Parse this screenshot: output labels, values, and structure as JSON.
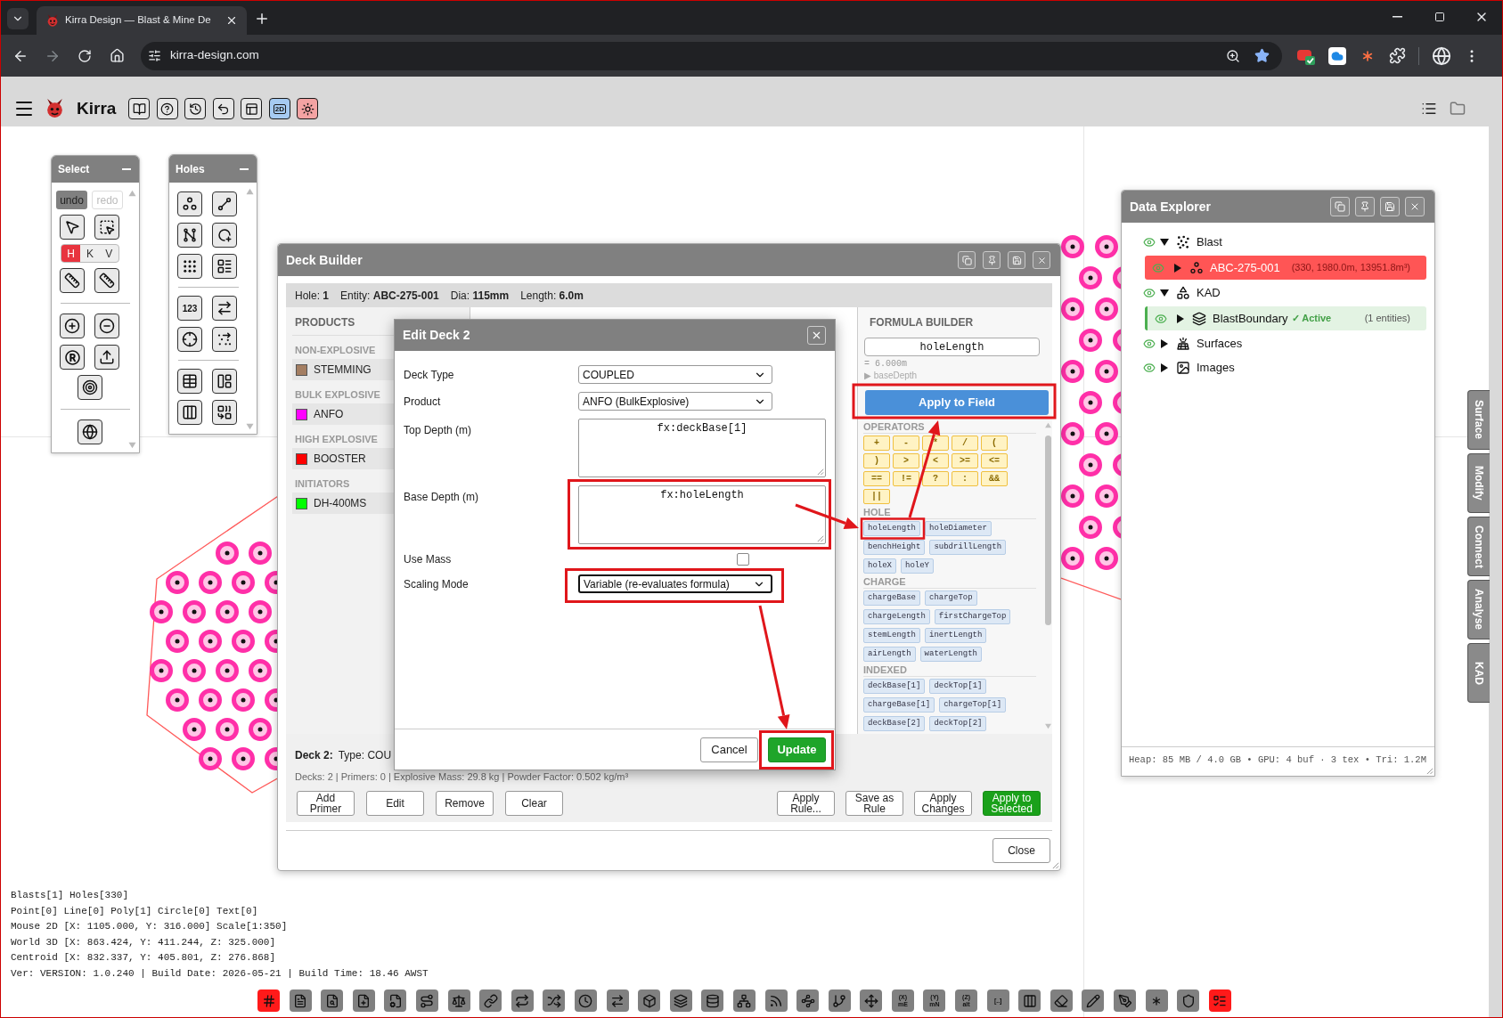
{
  "browser": {
    "tab_title": "Kirra Design — Blast & Mine De",
    "url": "kirra-design.com"
  },
  "app_header": {
    "app_name": "Kirra",
    "tools": [
      {
        "kind": "book",
        "selected": false
      },
      {
        "kind": "help",
        "selected": false
      },
      {
        "kind": "history",
        "selected": false
      },
      {
        "kind": "undo",
        "selected": false
      },
      {
        "kind": "layout",
        "selected": false
      },
      {
        "kind": "view",
        "label": "2D",
        "selected": true
      },
      {
        "kind": "theme",
        "selected": true
      }
    ]
  },
  "select_panel": {
    "title": "Select",
    "history": [
      {
        "label": "undo",
        "disabled": false
      },
      {
        "label": "redo",
        "disabled": true
      }
    ],
    "modes": [
      {
        "label": "H",
        "selected": true
      },
      {
        "label": "K",
        "selected": false
      },
      {
        "label": "V",
        "selected": false
      }
    ]
  },
  "holes_panel": {
    "title": "Holes",
    "numbering_label": "123"
  },
  "deck_builder": {
    "title": "Deck Builder",
    "info": [
      "Hole: **1**",
      "Entity: **ABC-275-001**",
      "Dia: **115mm**",
      "Length: **6.0m**"
    ],
    "products": {
      "title": "PRODUCTS",
      "groups": [
        {
          "title": "NON-EXPLOSIVE",
          "items": [
            {
              "name": "STEMMING",
              "color": "#a47e62"
            }
          ]
        },
        {
          "title": "BULK EXPLOSIVE",
          "items": [
            {
              "name": "ANFO",
              "color": "#ff00ff"
            }
          ]
        },
        {
          "title": "HIGH EXPLOSIVE",
          "items": [
            {
              "name": "BOOSTER",
              "color": "#ff0000"
            }
          ]
        },
        {
          "title": "INITIATORS",
          "items": [
            {
              "name": "DH-400MS",
              "color": "#00ff00"
            }
          ]
        }
      ]
    },
    "formula_builder": {
      "title": "FORMULA BUILDER",
      "input": "holeLength",
      "result": "= 6.000m",
      "target": "▶ baseDepth",
      "apply_button": "Apply to Field",
      "sections": [
        {
          "title": "OPERATORS",
          "kind": "operator",
          "chips": [
            "+",
            "-",
            "*",
            "/",
            "(",
            ")",
            ">",
            "<",
            ">=",
            "<=",
            "==",
            "!=",
            "?",
            ":",
            "&&",
            "||"
          ]
        },
        {
          "title": "HOLE",
          "kind": "variable",
          "chips": [
            "holeLength",
            "holeDiameter",
            "benchHeight",
            "subdrillLength",
            "holeX",
            "holeY"
          ]
        },
        {
          "title": "CHARGE",
          "kind": "variable",
          "chips": [
            "chargeBase",
            "chargeTop",
            "chargeLength",
            "firstChargeTop",
            "stemLength",
            "inertLength",
            "airLength",
            "waterLength"
          ]
        },
        {
          "title": "INDEXED",
          "kind": "variable",
          "chips": [
            "deckBase[1]",
            "deckTop[1]",
            "chargeBase[1]",
            "chargeTop[1]",
            "deckBase[2]",
            "deckTop[2]"
          ]
        }
      ]
    },
    "deck_summary": {
      "title": "Deck 2:",
      "type": "Type: COU",
      "stats": "Decks: 2 | Primers: 0 | Explosive Mass: 29.8 kg | Powder Factor: 0.502 kg/m³"
    },
    "actions": {
      "left": [
        {
          "label": "Add Primer",
          "primary": false
        },
        {
          "label": "Edit",
          "primary": false
        },
        {
          "label": "Remove",
          "primary": false
        },
        {
          "label": "Clear",
          "primary": false
        }
      ],
      "right": [
        {
          "label": "Apply Rule...",
          "primary": false
        },
        {
          "label": "Save as Rule",
          "primary": false
        },
        {
          "label": "Apply Changes",
          "primary": false
        },
        {
          "label": "Apply to Selected",
          "primary": true
        }
      ]
    },
    "close_button": "Close"
  },
  "edit_dialog": {
    "title": "Edit Deck 2",
    "fields": [
      {
        "kind": "select",
        "label": "Deck Type",
        "value": "COUPLED",
        "focused": false
      },
      {
        "kind": "select",
        "label": "Product",
        "value": "ANFO (BulkExplosive)",
        "focused": false
      },
      {
        "kind": "textarea",
        "label": "Top Depth (m)",
        "value": "fx:deckBase[1]"
      },
      {
        "kind": "textarea",
        "label": "Base Depth (m)",
        "value": "fx:holeLength"
      },
      {
        "kind": "checkbox",
        "label": "Use Mass",
        "checked": false
      },
      {
        "kind": "select",
        "label": "Scaling Mode",
        "value": "Variable (re-evaluates formula)",
        "focused": true
      }
    ],
    "buttons": [
      {
        "label": "Cancel",
        "primary": false
      },
      {
        "label": "Update",
        "primary": true
      }
    ]
  },
  "data_explorer": {
    "title": "Data Explorer",
    "tree": [
      {
        "kind": "blast",
        "label": "Blast",
        "visible": true,
        "expanded": true,
        "selected": false,
        "active": false,
        "children": [
          {
            "kind": "holes",
            "label": "ABC-275-001",
            "detail": "(330, 1980.0m, 13951.8m³)",
            "visible": true,
            "expanded": false,
            "selected": true,
            "active": false
          }
        ]
      },
      {
        "kind": "kad",
        "label": "KAD",
        "visible": true,
        "expanded": true,
        "selected": false,
        "active": false,
        "children": [
          {
            "kind": "layer",
            "label": "BlastBoundary",
            "status": "✓ Active",
            "detail": "(1 entities)",
            "visible": true,
            "expanded": false,
            "selected": false,
            "active": true
          }
        ]
      },
      {
        "kind": "surfaces",
        "label": "Surfaces",
        "visible": true,
        "expanded": false,
        "selected": false,
        "active": false
      },
      {
        "kind": "images",
        "label": "Images",
        "visible": true,
        "expanded": false,
        "selected": false,
        "active": false
      }
    ],
    "footer": "Heap: 85 MB / 4.0 GB • GPU: 4 buf · 3 tex • Tri: 1.2M"
  },
  "side_tabs": [
    "Surface",
    "Modify",
    "Connect",
    "Analyse",
    "KAD"
  ],
  "status_lines": [
    "Blasts[1] Holes[330]",
    "Point[0] Line[0] Poly[1] Circle[0] Text[0]",
    "Mouse 2D [X: 1105.000, Y: 316.000] Scale[1:350]",
    "World 3D [X: 863.424, Y: 411.244, Z: 325.000]",
    "Centroid [X: 832.337, Y: 405.801, Z: 276.868]",
    "Ver: VERSION: 1.0.240 | Build Date: 2026-05-21 | Build Time: 18.46 AWST"
  ],
  "bottom_toolbar": [
    {
      "selected": true
    },
    {
      "selected": false
    },
    {
      "selected": false
    },
    {
      "selected": false
    },
    {
      "selected": false
    },
    {
      "selected": false
    },
    {
      "selected": false
    },
    {
      "selected": false
    },
    {
      "selected": false
    },
    {
      "selected": false
    },
    {
      "selected": false
    },
    {
      "selected": false
    },
    {
      "selected": false
    },
    {
      "selected": false
    },
    {
      "selected": false
    },
    {
      "selected": false
    },
    {
      "selected": false
    },
    {
      "selected": false
    },
    {
      "selected": false
    },
    {
      "selected": false
    },
    {
      "label": "(X) mE",
      "selected": false
    },
    {
      "label": "(Y) mN",
      "selected": false
    },
    {
      "label": "(Z) alt",
      "selected": false
    },
    {
      "label": "[..]",
      "selected": false
    },
    {
      "selected": false
    },
    {
      "selected": false
    },
    {
      "selected": false
    },
    {
      "selected": false
    },
    {
      "selected": false
    },
    {
      "selected": false
    },
    {
      "selected": true
    }
  ]
}
